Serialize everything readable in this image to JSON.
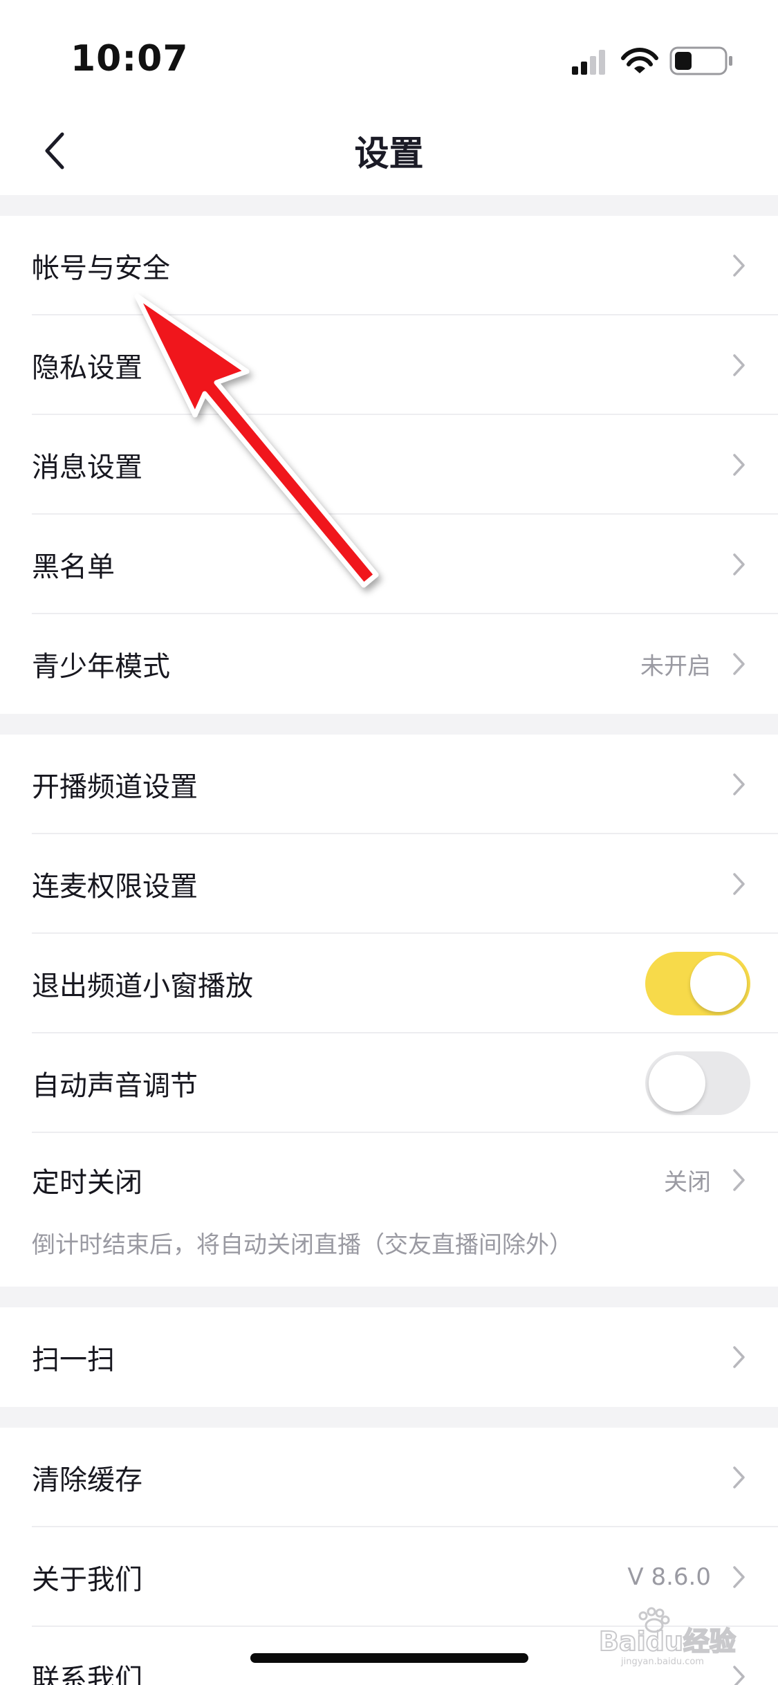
{
  "status_bar": {
    "time": "10:07",
    "battery_level": 0.35
  },
  "nav": {
    "title": "设置",
    "back_icon": "chevron-left-icon"
  },
  "sections": [
    {
      "items": [
        {
          "label": "帐号与安全"
        },
        {
          "label": "隐私设置"
        },
        {
          "label": "消息设置"
        },
        {
          "label": "黑名单"
        },
        {
          "label": "青少年模式",
          "value": "未开启"
        }
      ]
    },
    {
      "items": [
        {
          "label": "开播频道设置"
        },
        {
          "label": "连麦权限设置"
        },
        {
          "label": "退出频道小窗播放",
          "toggle": true
        },
        {
          "label": "自动声音调节",
          "toggle": false
        },
        {
          "label": "定时关闭",
          "value": "关闭",
          "description": "倒计时结束后，将自动关闭直播（交友直播间除外）"
        }
      ]
    },
    {
      "items": [
        {
          "label": "扫一扫"
        }
      ]
    },
    {
      "items": [
        {
          "label": "清除缓存"
        },
        {
          "label": "关于我们",
          "value": "V 8.6.0"
        },
        {
          "label": "联系我们"
        }
      ]
    }
  ],
  "annotation": {
    "icon": "red-arrow-icon",
    "color": "#f0141e"
  },
  "watermark": {
    "text": "Baidu经验",
    "url_text": "jingyan.baidu.com"
  },
  "colors": {
    "toggle_on": "#f7da4a",
    "toggle_off": "#e8e8ea",
    "section_gap": "#f3f3f5",
    "secondary_text": "#9a9aa2"
  }
}
